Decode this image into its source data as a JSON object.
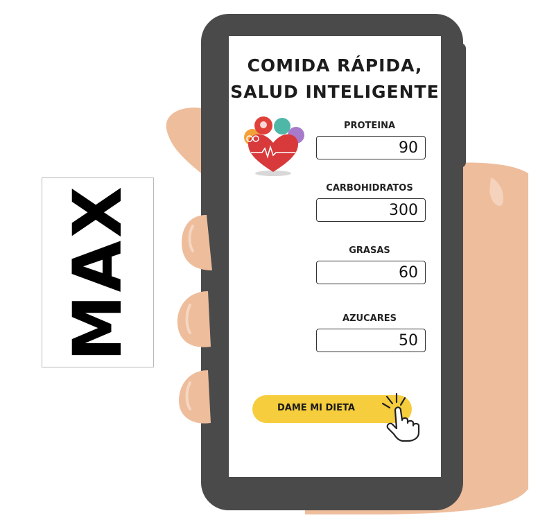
{
  "side_label": "MAX",
  "app": {
    "title_line1": "COMIDA RÁPIDA,",
    "title_line2": "SALUD INTELIGENTE"
  },
  "fields": [
    {
      "label": "PROTEINA",
      "value": "90"
    },
    {
      "label": "CARBOHIDRATOS",
      "value": "300"
    },
    {
      "label": "GRASAS",
      "value": "60"
    },
    {
      "label": "AZUCARES",
      "value": "50"
    }
  ],
  "button": {
    "label": "DAME MI DIETA"
  },
  "colors": {
    "phone_frame": "#4a4a4a",
    "skin": "#eebd9c",
    "button": "#f6cd3c",
    "heart": "#d8393b"
  },
  "icons": [
    "health-logo-icon",
    "pointer-hand-icon"
  ]
}
